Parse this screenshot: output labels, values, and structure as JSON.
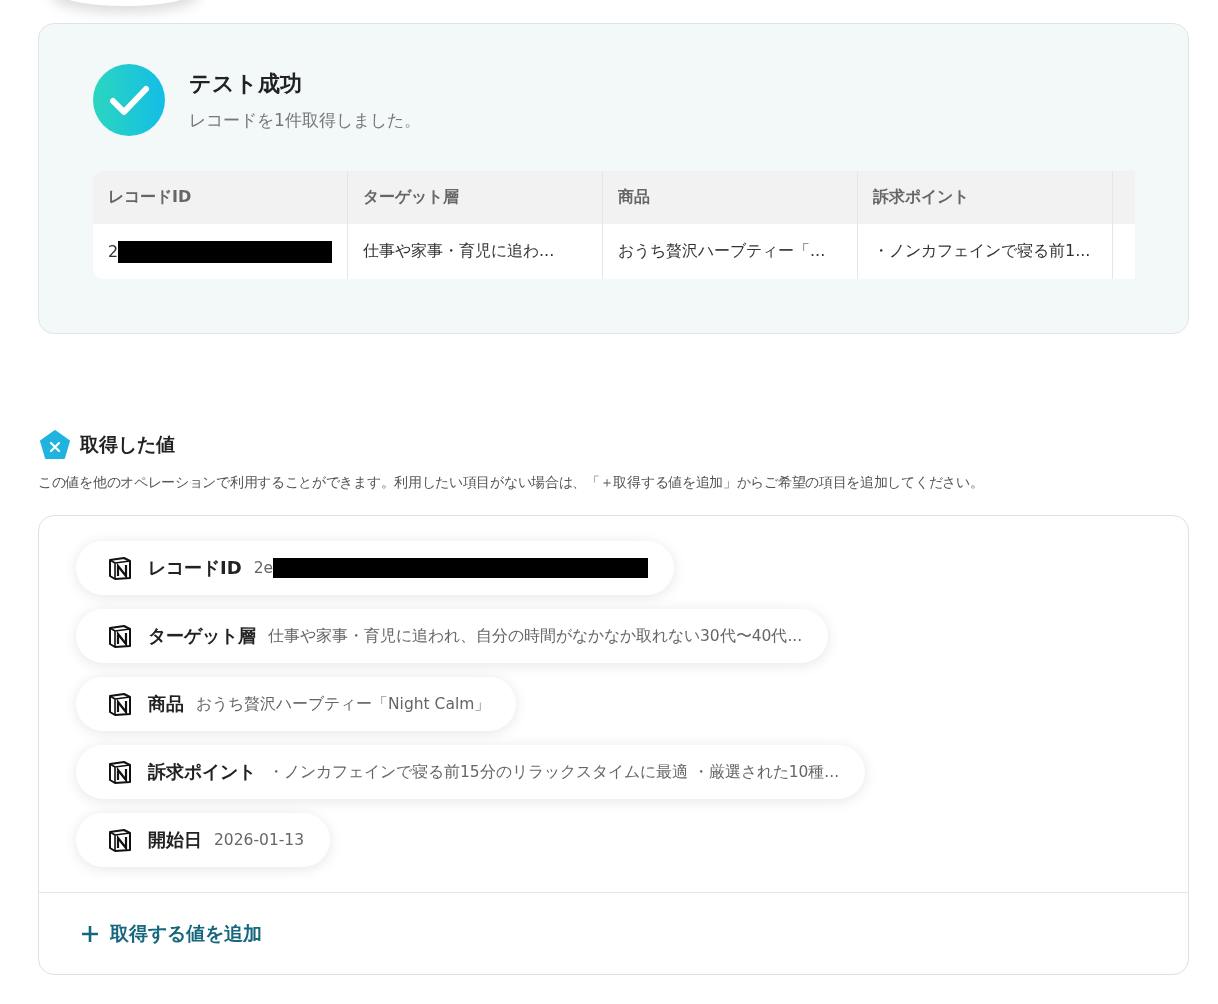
{
  "result": {
    "title": "テスト成功",
    "message": "レコードを1件取得しました。",
    "table": {
      "columns": [
        "レコードID",
        "ターゲット層",
        "商品",
        "訴求ポイント"
      ],
      "rows": [
        {
          "cells": [
            {
              "text": "2",
              "redacted": true
            },
            {
              "text": "仕事や家事・育児に追わ...",
              "redacted": false
            },
            {
              "text": "おうち贅沢ハーブティー「...",
              "redacted": false
            },
            {
              "text": "・ノンカフェインで寝る前1...",
              "redacted": false
            }
          ]
        }
      ]
    }
  },
  "values": {
    "title": "取得した値",
    "description": "この値を他のオペレーションで利用することができます。利用したい項目がない場合は、「＋取得する値を追加」からご希望の項目を追加してください。",
    "items": [
      {
        "label": "レコードID",
        "value": "2e",
        "redacted": true
      },
      {
        "label": "ターゲット層",
        "value": "仕事や家事・育児に追われ、自分の時間がなかなか取れない30代〜40代...",
        "redacted": false
      },
      {
        "label": "商品",
        "value": "おうち贅沢ハーブティー「Night Calm」",
        "redacted": false
      },
      {
        "label": "訴求ポイント",
        "value": "・ノンカフェインで寝る前15分のリラックスタイムに最適 ・厳選された10種...",
        "redacted": false
      },
      {
        "label": "開始日",
        "value": "2026-01-13",
        "redacted": false
      }
    ],
    "add_button": "取得する値を追加"
  }
}
